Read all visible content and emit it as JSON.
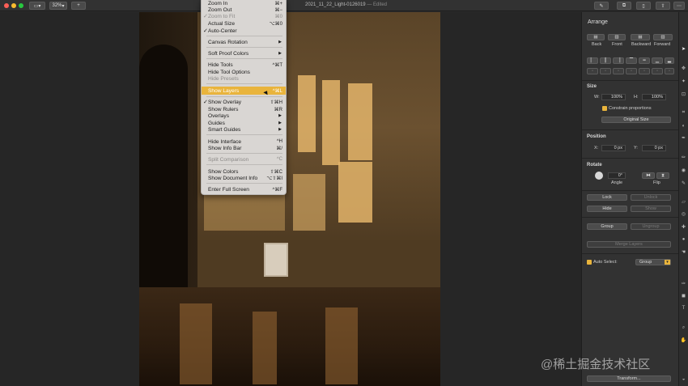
{
  "titlebar": {
    "zoom": "32%",
    "doc_title": "2021_11_22_Light-0126019",
    "doc_status": "— Edited",
    "add_label": "+"
  },
  "menu": {
    "items": [
      {
        "label": "Zoom In",
        "shortcut": "⌘+",
        "check": "",
        "disabled": false
      },
      {
        "label": "Zoom Out",
        "shortcut": "⌘−",
        "check": "",
        "disabled": false
      },
      {
        "label": "Zoom to Fit",
        "shortcut": "⌘0",
        "check": "✓",
        "disabled": true
      },
      {
        "label": "Actual Size",
        "shortcut": "⌥⌘0",
        "check": "",
        "disabled": false
      },
      {
        "label": "Auto-Center",
        "shortcut": "",
        "check": "✓",
        "disabled": false
      },
      {
        "label": "Canvas Rotation",
        "shortcut": "",
        "check": "",
        "disabled": false,
        "submenu": true
      },
      {
        "label": "Soft Proof Colors",
        "shortcut": "",
        "check": "",
        "disabled": false,
        "submenu": true
      },
      {
        "label": "Hide Tools",
        "shortcut": "^⌘T",
        "check": "",
        "disabled": false
      },
      {
        "label": "Hide Tool Options",
        "shortcut": "",
        "check": "",
        "disabled": false
      },
      {
        "label": "Hide Presets",
        "shortcut": "",
        "check": "",
        "disabled": true
      },
      {
        "label": "Show Layers",
        "shortcut": "^⌘L",
        "check": "",
        "disabled": false,
        "highlight": true
      },
      {
        "label": "Show Overlay",
        "shortcut": "⇧⌘H",
        "check": "✓",
        "disabled": false
      },
      {
        "label": "Show Rulers",
        "shortcut": "⌘R",
        "check": "",
        "disabled": false
      },
      {
        "label": "Overlays",
        "shortcut": "",
        "check": "",
        "disabled": false,
        "submenu": true
      },
      {
        "label": "Guides",
        "shortcut": "",
        "check": "",
        "disabled": false,
        "submenu": true
      },
      {
        "label": "Smart Guides",
        "shortcut": "",
        "check": "",
        "disabled": false,
        "submenu": true
      },
      {
        "label": "Hide Interface",
        "shortcut": "^H",
        "check": "",
        "disabled": false
      },
      {
        "label": "Show Info Bar",
        "shortcut": "⌘/",
        "check": "",
        "disabled": false
      },
      {
        "label": "Split Comparison",
        "shortcut": "^C",
        "check": "",
        "disabled": true
      },
      {
        "label": "Show Colors",
        "shortcut": "⇧⌘C",
        "check": "",
        "disabled": false
      },
      {
        "label": "Show Document Info",
        "shortcut": "⌥⇧⌘I",
        "check": "",
        "disabled": false
      },
      {
        "label": "Enter Full Screen",
        "shortcut": "^⌘F",
        "check": "",
        "disabled": false
      }
    ]
  },
  "panel": {
    "title": "Arrange",
    "order_buttons": [
      "Back",
      "Front",
      "Backward",
      "Forward"
    ],
    "size_head": "Size",
    "w_label": "W:",
    "w_value": "100%",
    "h_label": "H:",
    "h_value": "100%",
    "constrain": "Constrain proportions",
    "original_size": "Original Size",
    "position_head": "Position",
    "x_label": "X:",
    "x_value": "0 px",
    "y_label": "Y:",
    "y_value": "0 px",
    "rotate_head": "Rotate",
    "angle_value": "0°",
    "angle_label": "Angle",
    "flip_label": "Flip",
    "lock": "Lock",
    "unlock": "Unlock",
    "hide": "Hide",
    "show": "Show",
    "group": "Group",
    "ungroup": "Ungroup",
    "merge": "Merge Layers",
    "auto_select": "Auto Select:",
    "auto_select_value": "Group",
    "transform": "Transform..."
  },
  "watermark": "@稀土掘金技术社区",
  "colors": {
    "accent": "#e9b43c",
    "menu_bg": "#d9d6d3",
    "panel_bg": "#323232"
  }
}
